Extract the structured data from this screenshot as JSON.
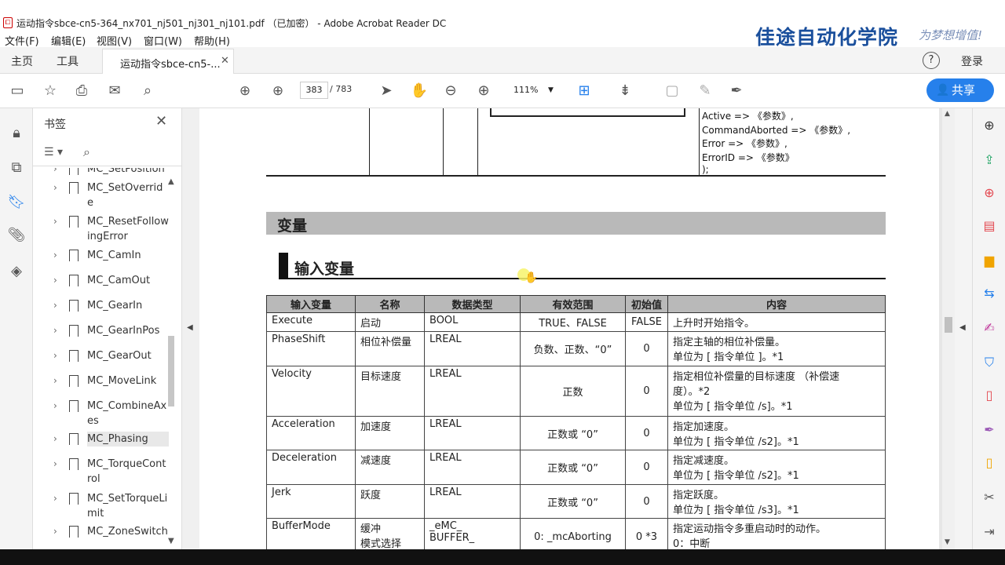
{
  "window": {
    "title": "运动指令sbce-cn5-364_nx701_nj501_nj301_nj101.pdf （已加密） - Adobe Acrobat Reader DC"
  },
  "menu": [
    "文件(F)",
    "编辑(E)",
    "视图(V)",
    "窗口(W)",
    "帮助(H)"
  ],
  "watermark": {
    "brand": "佳途自动化学院",
    "slogan": "为梦想增值!"
  },
  "tabs": {
    "home": "主页",
    "tools": "工具",
    "doc_tab": "运动指令sbce-cn5-...",
    "login": "登录"
  },
  "toolbar": {
    "page_current": "383",
    "page_total": "/ 783",
    "zoom": "111%",
    "share": "共享"
  },
  "bookmarks": {
    "title": "书签",
    "items": [
      {
        "label": "MC_SetPosition",
        "selected": false
      },
      {
        "label": "MC_SetOverride",
        "selected": false
      },
      {
        "label": "MC_ResetFollowingError",
        "selected": false
      },
      {
        "label": "MC_CamIn",
        "selected": false
      },
      {
        "label": "MC_CamOut",
        "selected": false
      },
      {
        "label": "MC_GearIn",
        "selected": false
      },
      {
        "label": "MC_GearInPos",
        "selected": false
      },
      {
        "label": "MC_GearOut",
        "selected": false
      },
      {
        "label": "MC_MoveLink",
        "selected": false
      },
      {
        "label": "MC_CombineAxes",
        "selected": false
      },
      {
        "label": "MC_Phasing",
        "selected": true
      },
      {
        "label": "MC_TorqueControl",
        "selected": false
      },
      {
        "label": "MC_SetTorqueLimit",
        "selected": false
      },
      {
        "label": "MC_ZoneSwitch",
        "selected": false
      }
    ]
  },
  "document": {
    "code_lines": [
      "Active => 《参数》,",
      "CommandAborted => 《参数》,",
      "Error => 《参数》,",
      "ErrorID => 《参数》",
      ");"
    ],
    "section_title": "变量",
    "subsection_title": "输入变量",
    "table": {
      "headers": [
        "输入变量",
        "名称",
        "数据类型",
        "有效范围",
        "初始值",
        "内容"
      ],
      "rows": [
        {
          "var": "Execute",
          "name": "启动",
          "type": "BOOL",
          "range": "TRUE、FALSE",
          "init": "FALSE",
          "desc": [
            "上升时开始指令。"
          ]
        },
        {
          "var": "PhaseShift",
          "name": "相位补偿量",
          "type": "LREAL",
          "range": "负数、正数、“0”",
          "init": "0",
          "desc": [
            "指定主轴的相位补偿量。",
            "单位为 [ 指令单位 ]。*1"
          ]
        },
        {
          "var": "Velocity",
          "name": "目标速度",
          "type": "LREAL",
          "range": "正数",
          "init": "0",
          "desc": [
            "指定相位补偿量的目标速度 （补偿速",
            "度）。*2",
            "单位为 [ 指令单位 /s]。*1"
          ]
        },
        {
          "var": "Acceleration",
          "name": "加速度",
          "type": "LREAL",
          "range": "正数或 “0”",
          "init": "0",
          "desc": [
            "指定加速度。",
            "单位为 [ 指令单位 /s2]。*1"
          ]
        },
        {
          "var": "Deceleration",
          "name": "减速度",
          "type": "LREAL",
          "range": "正数或 “0”",
          "init": "0",
          "desc": [
            "指定减速度。",
            "单位为 [ 指令单位 /s2]。*1"
          ]
        },
        {
          "var": "Jerk",
          "name": "跃度",
          "type": "LREAL",
          "range": "正数或 “0”",
          "init": "0",
          "desc": [
            "指定跃度。",
            "单位为 [ 指令单位 /s3]。*1"
          ]
        },
        {
          "var": "BufferMode",
          "name": "缓冲\n模式选择",
          "type": "_eMC_\nBUFFER_",
          "range": "0: _mcAborting",
          "init": "0 *3",
          "desc": [
            "指定运动指令多重启动时的动作。",
            "0：中断"
          ]
        }
      ]
    }
  },
  "colors": {
    "accent": "#2680eb",
    "brand": "#1a4f9c",
    "header_gray": "#b9b9b9"
  }
}
